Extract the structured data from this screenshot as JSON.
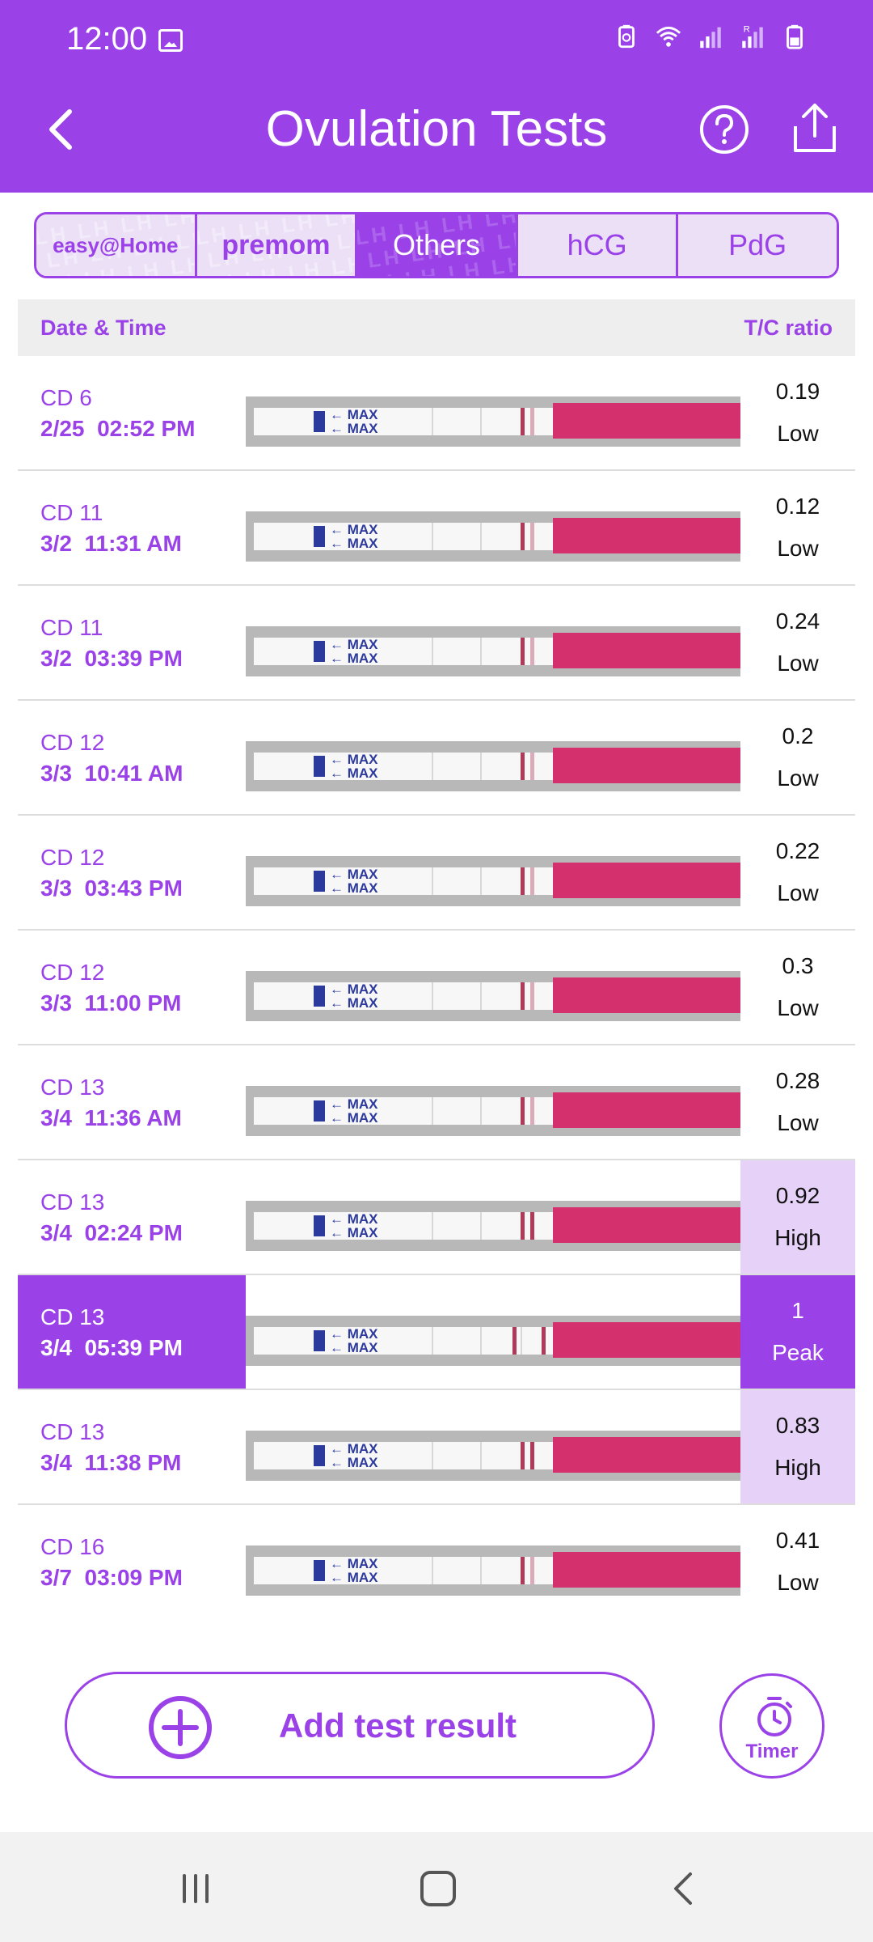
{
  "status_bar": {
    "time": "12:00"
  },
  "header": {
    "title": "Ovulation Tests"
  },
  "tabs": [
    {
      "label": "easy@Home",
      "brand": "easy",
      "active": false
    },
    {
      "label": "premom",
      "brand": "premom",
      "active": false
    },
    {
      "label": "Others",
      "brand": "",
      "active": true
    },
    {
      "label": "hCG",
      "brand": "",
      "active": false
    },
    {
      "label": "PdG",
      "brand": "",
      "active": false
    }
  ],
  "table": {
    "col_date": "Date & Time",
    "col_ratio": "T/C ratio",
    "rows": [
      {
        "cd": "CD 6",
        "date": "2/25",
        "time": "02:52 PM",
        "ratio": "0.19",
        "level": "Low"
      },
      {
        "cd": "CD 11",
        "date": "3/2",
        "time": "11:31 AM",
        "ratio": "0.12",
        "level": "Low"
      },
      {
        "cd": "CD 11",
        "date": "3/2",
        "time": "03:39 PM",
        "ratio": "0.24",
        "level": "Low"
      },
      {
        "cd": "CD 12",
        "date": "3/3",
        "time": "10:41 AM",
        "ratio": "0.2",
        "level": "Low"
      },
      {
        "cd": "CD 12",
        "date": "3/3",
        "time": "03:43 PM",
        "ratio": "0.22",
        "level": "Low"
      },
      {
        "cd": "CD 12",
        "date": "3/3",
        "time": "11:00 PM",
        "ratio": "0.3",
        "level": "Low"
      },
      {
        "cd": "CD 13",
        "date": "3/4",
        "time": "11:36 AM",
        "ratio": "0.28",
        "level": "Low"
      },
      {
        "cd": "CD 13",
        "date": "3/4",
        "time": "02:24 PM",
        "ratio": "0.92",
        "level": "High"
      },
      {
        "cd": "CD 13",
        "date": "3/4",
        "time": "05:39 PM",
        "ratio": "1",
        "level": "Peak"
      },
      {
        "cd": "CD 13",
        "date": "3/4",
        "time": "11:38 PM",
        "ratio": "0.83",
        "level": "High"
      },
      {
        "cd": "CD 16",
        "date": "3/7",
        "time": "03:09 PM",
        "ratio": "0.41",
        "level": "Low"
      }
    ]
  },
  "strip_text": "MAX",
  "actions": {
    "add_label": "Add test result",
    "timer_label": "Timer"
  },
  "colors": {
    "accent": "#9a42e8",
    "high_bg": "#e6d2f8",
    "strip_pink": "#d4306e"
  }
}
